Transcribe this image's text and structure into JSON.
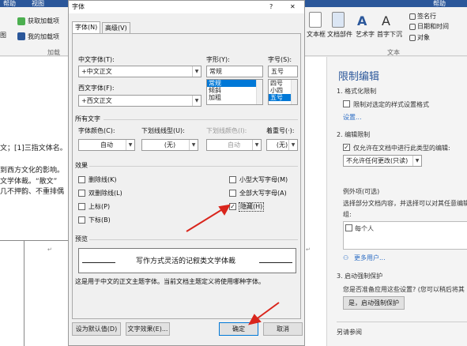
{
  "ribbon": {
    "tabs": [
      "帮助",
      "视图",
      "帮助"
    ],
    "left": {
      "get_addins": "获取加载项",
      "my_addins": "我的加载项",
      "group": "加载",
      "fig": "图"
    },
    "right": {
      "textbox": "文本框",
      "docparts": "文档部件",
      "wordart": "艺术字",
      "dropcap": "首字下沉",
      "signature": "签名行",
      "datetime": "日期和时间",
      "object": "对象",
      "group": "文本"
    }
  },
  "document": {
    "lines": [
      "文；[1]三指文体名。",
      "到西方文化的影响。",
      "文学体裁。“散文”",
      "几不押韵、不重排偶"
    ]
  },
  "pane": {
    "title": "限制编辑",
    "s1": "1. 格式化限制",
    "s1_check": "限制对选定的样式设置格式",
    "s1_link": "设置...",
    "s2": "2. 编辑限制",
    "s2_check": "仅允许在文档中进行此类型的编辑:",
    "s2_select": "不允许任何更改(只读)",
    "exceptions": "例外项(可选)",
    "exceptions_desc1": "选择部分文档内容，并选择可以对其任意编辑",
    "exceptions_desc2": "组:",
    "everyone": "每个人",
    "more_users": "更多用户...",
    "s3": "3. 启动强制保护",
    "s3_question": "您是否准备应用这些设置? (您可以稍后将其",
    "start_btn": "是，启动强制保护",
    "see_also": "另请参阅"
  },
  "dialog": {
    "title": "字体",
    "help": "?",
    "close": "✕",
    "tabs": [
      "字体(N)",
      "高级(V)"
    ],
    "cn_font_label": "中文字体(T):",
    "cn_font_value": "+中文正文",
    "west_font_label": "西文字体(F):",
    "west_font_value": "+西文正文",
    "style_label": "字形(Y):",
    "style_value": "常规",
    "style_options": [
      "常规",
      "倾斜",
      "加粗"
    ],
    "size_label": "字号(S):",
    "size_value": "五号",
    "size_options": [
      "四号",
      "小四",
      "五号"
    ],
    "all_text": "所有文字",
    "font_color_label": "字体颜色(C):",
    "font_color_value": "自动",
    "underline_label": "下划线线型(U):",
    "underline_value": "(无)",
    "underline_color_label": "下划线颜色(I):",
    "underline_color_value": "自动",
    "emphasis_label": "着重号(·):",
    "emphasis_value": "(无)",
    "effects": "效果",
    "strike": "删除线(K)",
    "double_strike": "双删除线(L)",
    "superscript": "上标(P)",
    "subscript": "下标(B)",
    "small_caps": "小型大写字母(M)",
    "all_caps": "全部大写字母(A)",
    "hidden": "隐藏(H)",
    "preview_label": "预览",
    "preview_text": "写作方式灵活的记叙类文学体裁",
    "preview_note": "这是用于中文的正文主题字体。当前文档主题定义将使用哪种字体。",
    "set_default": "设为默认值(D)",
    "text_effects": "文字效果(E)...",
    "ok": "确定",
    "cancel": "取消"
  },
  "colors": {
    "ribbon_blue": "#2b579a",
    "selection_blue": "#0078d7",
    "arrow_red": "#d9251c"
  }
}
